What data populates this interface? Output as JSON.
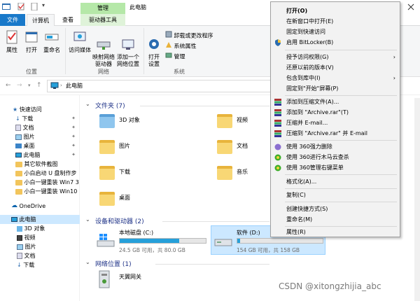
{
  "window": {
    "title": "此电脑"
  },
  "ribbon": {
    "context_tab": "管理",
    "tabs": [
      {
        "label": "文件"
      },
      {
        "label": "计算机"
      },
      {
        "label": "查看"
      },
      {
        "label": "驱动器工具"
      }
    ],
    "buttons": {
      "properties": "属性",
      "open": "打开",
      "rename": "重命名",
      "access_media": "访问媒体",
      "map_drive": "映射网络\n驱动器",
      "add_location": "添加一个\n网络位置",
      "open_settings": "打开\n设置",
      "uninstall": "卸载或更改程序",
      "system_props": "系统属性",
      "manage": "管理"
    },
    "groups": {
      "location": "位置",
      "network": "网络",
      "system": "系统"
    }
  },
  "address": {
    "path": "此电脑"
  },
  "nav": {
    "items": [
      {
        "label": "快速访问"
      },
      {
        "label": "下载"
      },
      {
        "label": "文档"
      },
      {
        "label": "图片"
      },
      {
        "label": "桌面"
      },
      {
        "label": "此电脑"
      },
      {
        "label": "其它软件截图"
      },
      {
        "label": "小白启动 U 盘制作步"
      },
      {
        "label": "小白一键重装 Win7 3"
      },
      {
        "label": "小白一键重装 Win10"
      },
      {
        "label": "OneDrive"
      },
      {
        "label": "此电脑"
      },
      {
        "label": "3D 对象"
      },
      {
        "label": "视频"
      },
      {
        "label": "图片"
      },
      {
        "label": "文档"
      },
      {
        "label": "下载"
      }
    ]
  },
  "content": {
    "folders_header": "文件夹 (7)",
    "folders": [
      {
        "label": "3D 对象"
      },
      {
        "label": "视频"
      },
      {
        "label": "图片"
      },
      {
        "label": "文档"
      },
      {
        "label": "下载"
      },
      {
        "label": "音乐"
      },
      {
        "label": "桌面"
      }
    ],
    "devices_header": "设备和驱动器 (2)",
    "drives": [
      {
        "label": "本地磁盘 (C:)",
        "free": "24.5 GB 可用，共 80.0 GB",
        "used_fraction": 0.69
      },
      {
        "label": "软件 (D:)",
        "free": "154 GB 可用，共 158 GB",
        "used_fraction": 0.03
      }
    ],
    "network_header": "网络位置 (1)",
    "network": [
      {
        "label": "天翼网关"
      }
    ]
  },
  "context_menu": {
    "items": [
      {
        "label": "打开(O)"
      },
      {
        "label": "在新窗口中打开(E)"
      },
      {
        "label": "固定到快速访问"
      },
      {
        "label": "启用 BitLocker(B)"
      },
      {
        "label": "授予访问权限(G)"
      },
      {
        "label": "还原以前的版本(V)"
      },
      {
        "label": "包含到库中(I)"
      },
      {
        "label": "固定到\"开始\"屏幕(P)"
      },
      {
        "label": "添加到压缩文件(A)..."
      },
      {
        "label": "添加到 \"Archive.rar\"(T)"
      },
      {
        "label": "压缩并 E-mail..."
      },
      {
        "label": "压缩到 \"Archive.rar\" 并 E-mail"
      },
      {
        "label": "使用 360强力删除"
      },
      {
        "label": "使用 360进行木马云查杀"
      },
      {
        "label": "使用 360管理右键菜单"
      },
      {
        "label": "格式化(A)..."
      },
      {
        "label": "复制(C)"
      },
      {
        "label": "创建快捷方式(S)"
      },
      {
        "label": "重命名(M)"
      },
      {
        "label": "属性(R)"
      }
    ]
  },
  "watermark": "CSDN @xitongzhijia_abc",
  "colors": {
    "accent": "#1979ca",
    "selection": "#cce8ff",
    "context_green": "#b5e8a8",
    "drive_fill": "#26a0da"
  }
}
